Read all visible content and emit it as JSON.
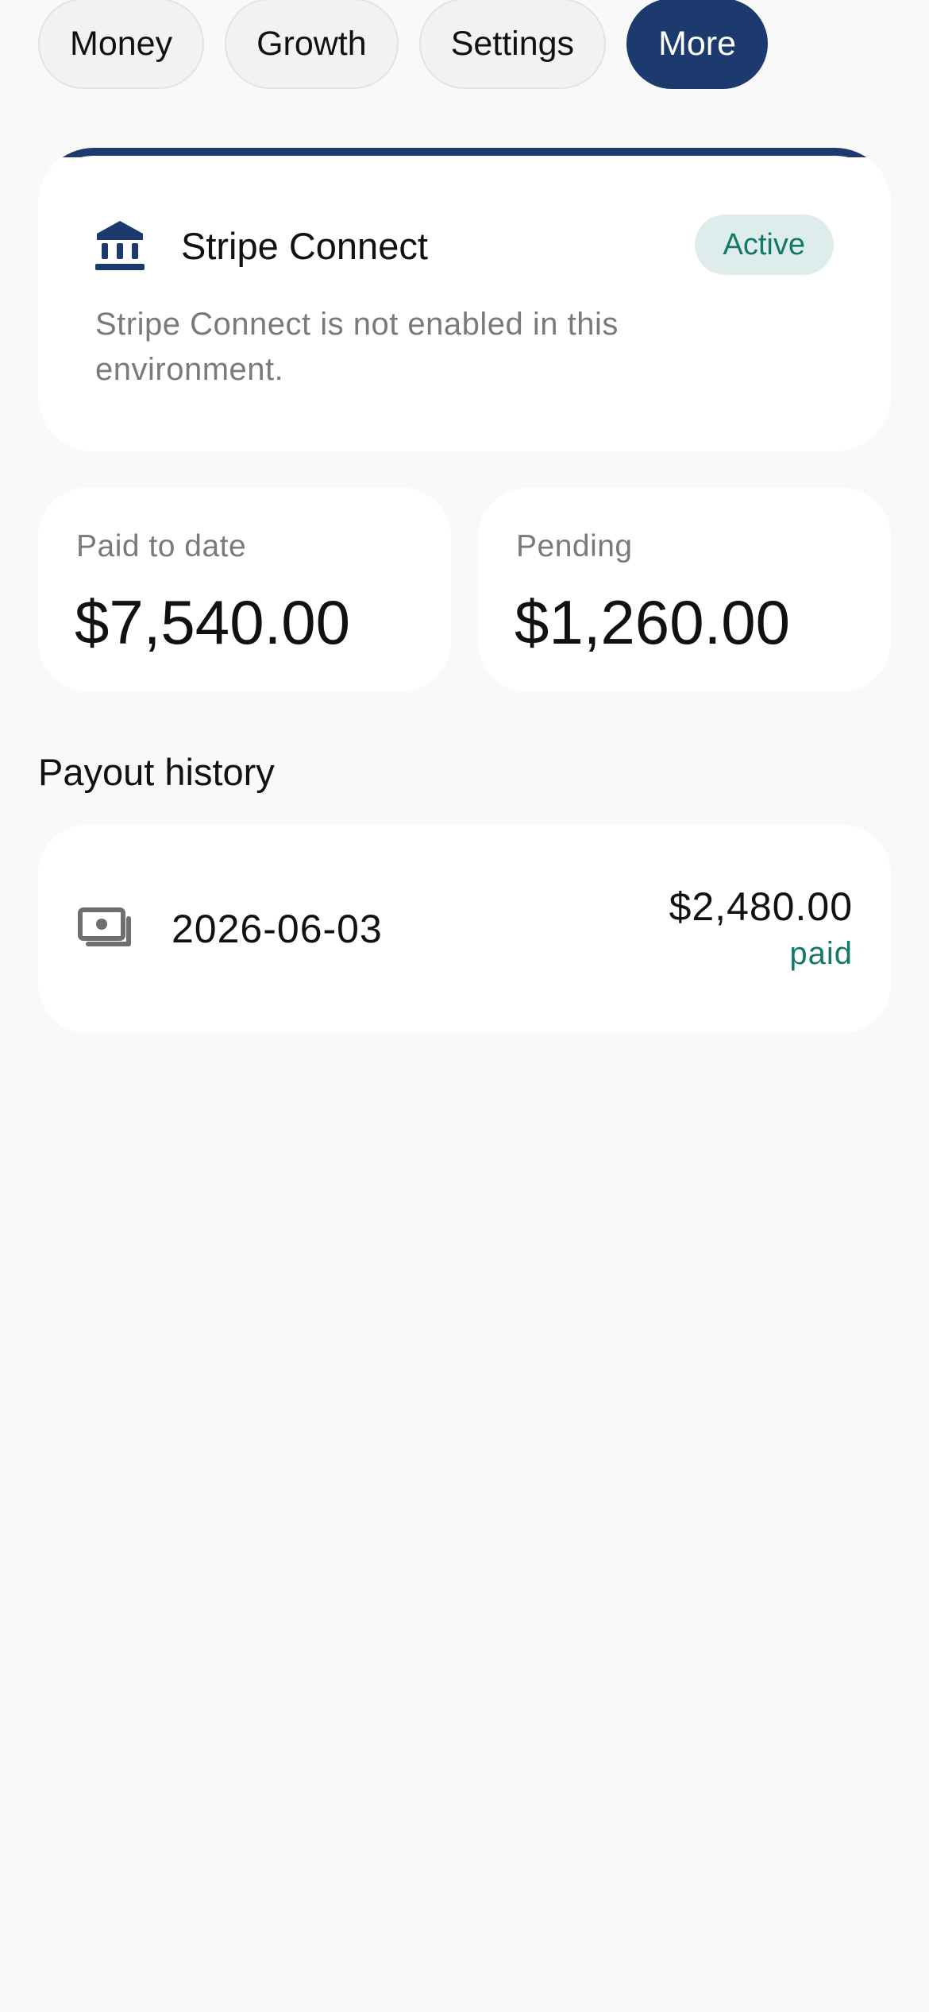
{
  "tabs": [
    {
      "label": "Money",
      "active": false
    },
    {
      "label": "Growth",
      "active": false
    },
    {
      "label": "Settings",
      "active": false
    },
    {
      "label": "More",
      "active": true
    }
  ],
  "stripe_connect": {
    "icon": "bank-icon",
    "title": "Stripe Connect",
    "status_badge": "Active",
    "description": "Stripe Connect is not enabled in this environment."
  },
  "stats": {
    "paid_to_date": {
      "label": "Paid to date",
      "value": "$7,540.00"
    },
    "pending": {
      "label": "Pending",
      "value": "$1,260.00"
    }
  },
  "payout_history": {
    "title": "Payout history",
    "items": [
      {
        "icon": "cash-icon",
        "date": "2026-06-03",
        "amount": "$2,480.00",
        "status": "paid"
      }
    ]
  },
  "colors": {
    "brand": "#1d3a6e",
    "success": "#13786a",
    "success_bg": "#deedeb",
    "background": "#f9f9f9",
    "muted_text": "#7a7a7a"
  }
}
